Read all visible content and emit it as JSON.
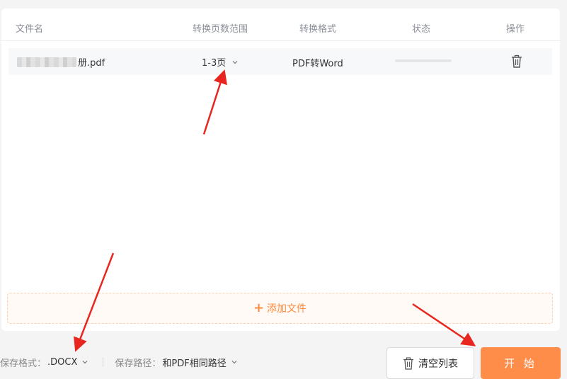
{
  "table": {
    "headers": {
      "name": "文件名",
      "range": "转换页数范围",
      "format": "转换格式",
      "status": "状态",
      "action": "操作"
    },
    "rows": [
      {
        "filename_visible": "册.pdf",
        "range": "1-3页",
        "format": "PDF转Word",
        "progress": 0
      }
    ]
  },
  "add_files": {
    "label": "添加文件"
  },
  "footer": {
    "save_format_label": "保存格式：",
    "save_format_value": ".DOCX",
    "save_path_label": "保存路径：",
    "save_path_value": "和PDF相同路径"
  },
  "buttons": {
    "clear": "清空列表",
    "start": "开 始"
  },
  "colors": {
    "accent": "#ff8d4a",
    "annotation_arrow": "#e8261f"
  },
  "icons": [
    "trash-icon",
    "chevron-down-icon",
    "plus-icon"
  ]
}
